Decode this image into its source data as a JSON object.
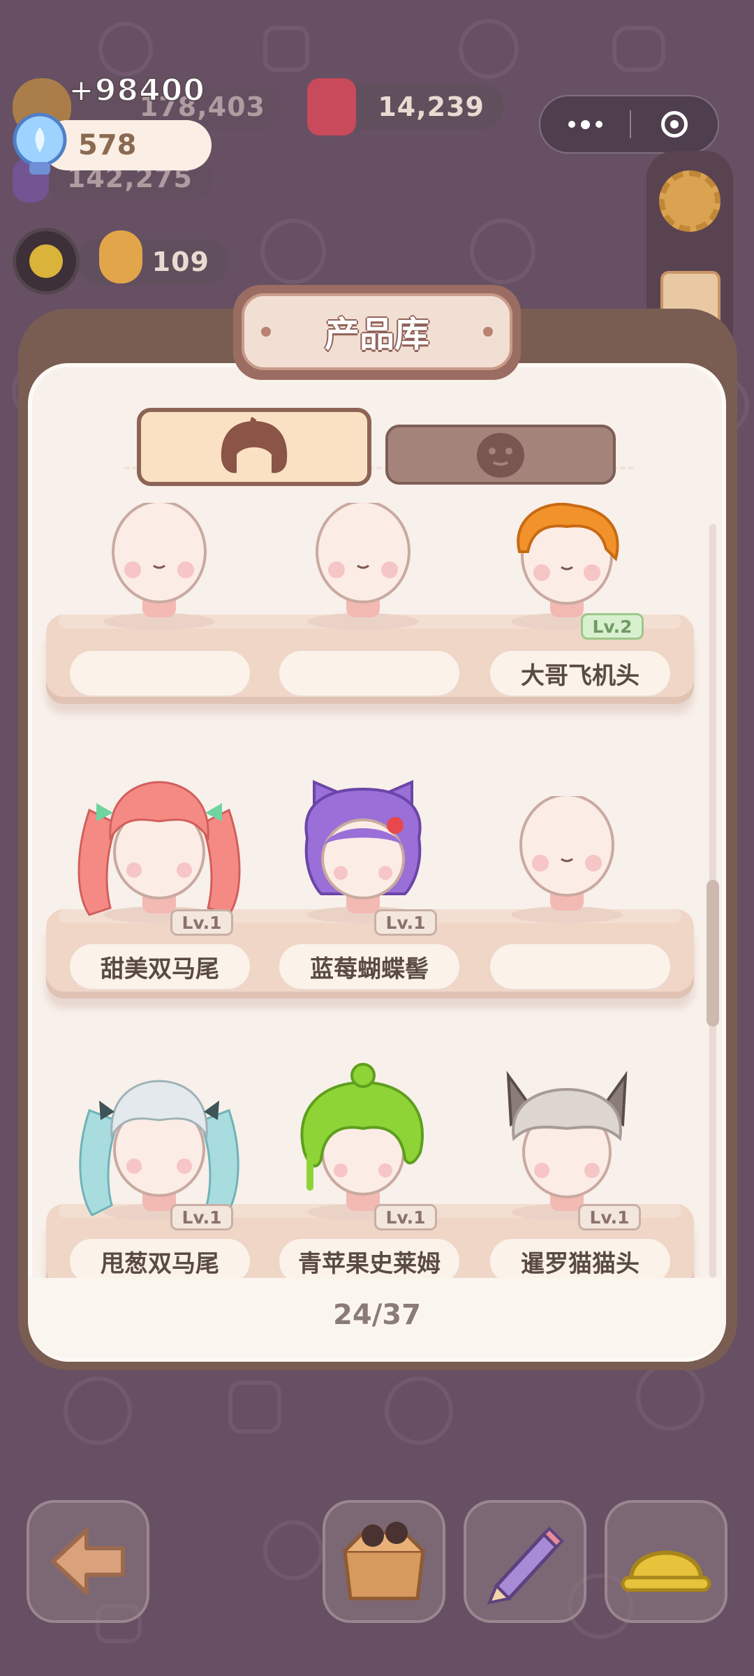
{
  "currency": {
    "bulb_value": "578",
    "floating_text": "+98400",
    "pill_a_value": "178,403",
    "pill_b_value": "14,239",
    "pill_c_value": "142,275",
    "pill_d_value": "109"
  },
  "modal": {
    "title": "产品库",
    "page_counter": "24/37",
    "tabs": [
      {
        "icon": "hair-icon",
        "active": true
      },
      {
        "icon": "face-mask-icon",
        "active": false
      }
    ],
    "shelves": [
      {
        "slots": [
          {
            "label": "",
            "level": ""
          },
          {
            "label": "",
            "level": ""
          },
          {
            "label": "大哥飞机头",
            "level": "Lv.2"
          }
        ]
      },
      {
        "slots": [
          {
            "label": "甜美双马尾",
            "level": "Lv.1"
          },
          {
            "label": "蓝莓蝴蝶髻",
            "level": "Lv.1"
          },
          {
            "label": "",
            "level": ""
          }
        ]
      },
      {
        "slots": [
          {
            "label": "甩葱双马尾",
            "level": "Lv.1"
          },
          {
            "label": "青苹果史莱姆",
            "level": "Lv.1"
          },
          {
            "label": "暹罗猫猫头",
            "level": "Lv.1"
          }
        ]
      }
    ]
  },
  "bottom_bar": [
    {
      "icon": "back-arrow-icon"
    },
    {
      "icon": "box-icon"
    },
    {
      "icon": "pencil-icon"
    },
    {
      "icon": "hard-hat-icon"
    }
  ]
}
